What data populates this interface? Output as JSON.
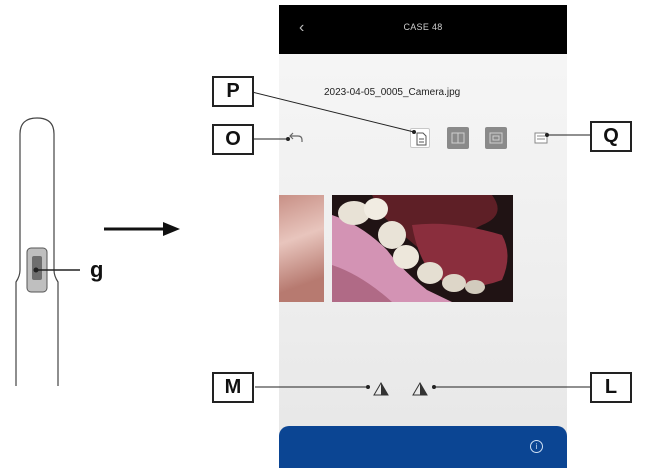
{
  "phone": {
    "header_title": "CASE 48",
    "filename": "2023-04-05_0005_Camera.jpg",
    "info_glyph": "i"
  },
  "callouts": {
    "p": "P",
    "o": "O",
    "q": "Q",
    "m": "M",
    "l": "L",
    "g": "g"
  },
  "icons": {
    "back": "back-chevron-icon",
    "undo": "undo-icon",
    "file": "file-icon",
    "compare": "compare-icon",
    "menu": "menu-icon",
    "rotate_left": "rotate-left-icon",
    "rotate_right": "rotate-right-icon",
    "info": "info-icon"
  },
  "colors": {
    "header": "#000000",
    "bottom_bar": "#0b4593",
    "dark_button": "#8a8a8a"
  }
}
